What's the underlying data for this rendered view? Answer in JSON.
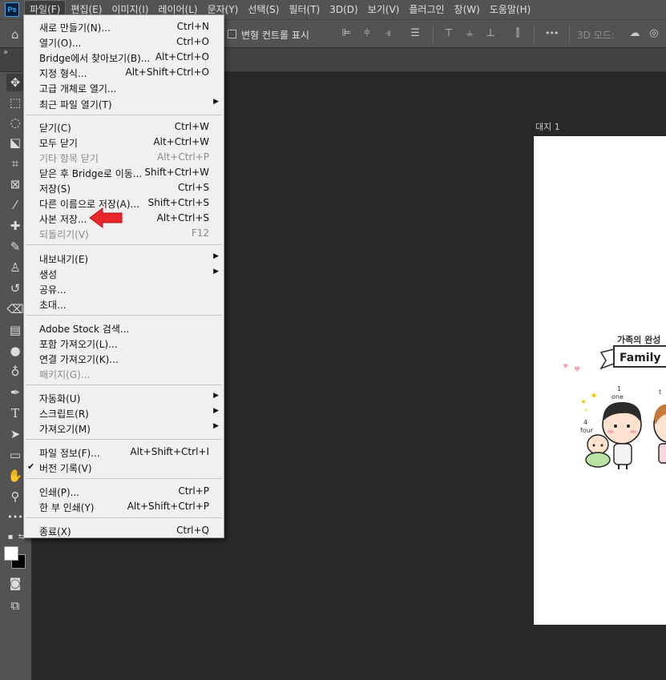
{
  "app": {
    "logo": "Ps"
  },
  "menubar": {
    "items": [
      "파일(F)",
      "편집(E)",
      "이미지(I)",
      "레이어(L)",
      "문자(Y)",
      "선택(S)",
      "필터(T)",
      "3D(D)",
      "보기(V)",
      "플러그인",
      "창(W)",
      "도움말(H)"
    ]
  },
  "options": {
    "transform_label": "변형 컨트롤 표시",
    "mode_3d": "3D 모드:",
    "more": "•••"
  },
  "document": {
    "artboard_label": "대지 1",
    "headline": "가족의 완성",
    "banner": "Family",
    "num_one": "1",
    "word_one": "one",
    "num_four": "4",
    "word_four": "four",
    "word_two_partial": "t"
  },
  "file_menu": {
    "new": {
      "label": "새로 만들기(N)...",
      "shortcut": "Ctrl+N"
    },
    "open": {
      "label": "열기(O)...",
      "shortcut": "Ctrl+O"
    },
    "bridge": {
      "label": "Bridge에서 찾아보기(B)...",
      "shortcut": "Alt+Ctrl+O"
    },
    "open_as": {
      "label": "지정 형식...",
      "shortcut": "Alt+Shift+Ctrl+O"
    },
    "open_smart": {
      "label": "고급 개체로 열기..."
    },
    "recent": {
      "label": "최근 파일 열기(T)"
    },
    "close": {
      "label": "닫기(C)",
      "shortcut": "Ctrl+W"
    },
    "close_all": {
      "label": "모두 닫기",
      "shortcut": "Alt+Ctrl+W"
    },
    "close_others": {
      "label": "기타 항목 닫기",
      "shortcut": "Alt+Ctrl+P"
    },
    "close_bridge": {
      "label": "닫은 후 Bridge로 이동...",
      "shortcut": "Shift+Ctrl+W"
    },
    "save": {
      "label": "저장(S)",
      "shortcut": "Ctrl+S"
    },
    "save_as": {
      "label": "다른 이름으로 저장(A)...",
      "shortcut": "Shift+Ctrl+S"
    },
    "save_copy": {
      "label": "사본 저장...",
      "shortcut": "Alt+Ctrl+S"
    },
    "revert": {
      "label": "되돌리기(V)",
      "shortcut": "F12"
    },
    "export": {
      "label": "내보내기(E)"
    },
    "generate": {
      "label": "생성"
    },
    "share": {
      "label": "공유..."
    },
    "invite": {
      "label": "초대..."
    },
    "stock": {
      "label": "Adobe Stock 검색..."
    },
    "place_embedded": {
      "label": "포함 가져오기(L)..."
    },
    "place_linked": {
      "label": "연결 가져오기(K)..."
    },
    "package": {
      "label": "패키지(G)..."
    },
    "automate": {
      "label": "자동화(U)"
    },
    "scripts": {
      "label": "스크립트(R)"
    },
    "import": {
      "label": "가져오기(M)"
    },
    "file_info": {
      "label": "파일 정보(F)...",
      "shortcut": "Alt+Shift+Ctrl+I"
    },
    "version_history": {
      "label": "버전 기록(V)"
    },
    "print": {
      "label": "인쇄(P)...",
      "shortcut": "Ctrl+P"
    },
    "print_one": {
      "label": "한 부 인쇄(Y)",
      "shortcut": "Alt+Shift+Ctrl+P"
    },
    "exit": {
      "label": "종료(X)",
      "shortcut": "Ctrl+Q"
    }
  },
  "colors": {
    "accent_red": "#e8262b",
    "ui_dark": "#535353",
    "menu_bg": "#f0f0f0"
  }
}
